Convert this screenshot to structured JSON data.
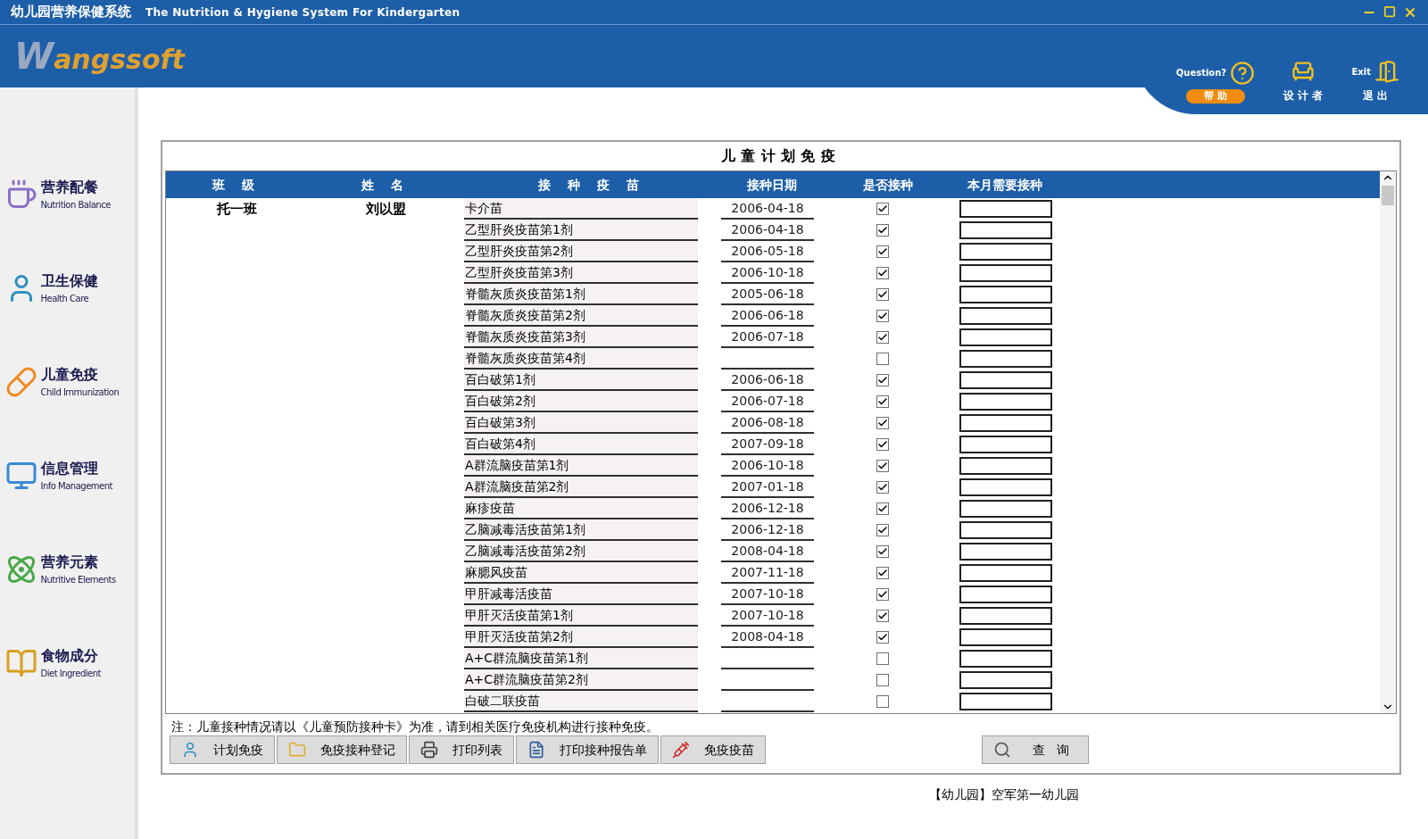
{
  "window": {
    "title": "幼儿园营养保健系统",
    "subtitle": "The Nutrition & Hygiene System For Kindergarten"
  },
  "logo": "Wangssoft",
  "top_actions": [
    {
      "kind": "help",
      "caption": "Question?",
      "label": "帮 助"
    },
    {
      "kind": "designer",
      "label": "设 计 者"
    },
    {
      "kind": "exit",
      "caption": "Exit",
      "label": "退 出"
    }
  ],
  "sidebar": {
    "items": [
      {
        "kind": "nutrition",
        "title": "营养配餐",
        "subtitle": "Nutrition Balance"
      },
      {
        "kind": "health",
        "title": "卫生保健",
        "subtitle": "Health Care"
      },
      {
        "kind": "immunization",
        "title": "儿童免疫",
        "subtitle": "Child Immunization"
      },
      {
        "kind": "info",
        "title": "信息管理",
        "subtitle": "Info Management"
      },
      {
        "kind": "elements",
        "title": "营养元素",
        "subtitle": "Nutritive Elements"
      },
      {
        "kind": "diet",
        "title": "食物成分",
        "subtitle": "Diet Ingredient"
      }
    ]
  },
  "panel": {
    "title": "儿童计划免疫"
  },
  "table": {
    "columns": [
      "班 级",
      "姓 名",
      "接 种 疫 苗",
      "接种日期",
      "是否接种",
      "本月需要接种"
    ],
    "student": {
      "class": "托一班",
      "name": "刘以盟"
    },
    "rows": [
      {
        "vaccine": "卡介苗",
        "date": "2006-04-18",
        "checked": true
      },
      {
        "vaccine": "乙型肝炎疫苗第1剂",
        "date": "2006-04-18",
        "checked": true
      },
      {
        "vaccine": "乙型肝炎疫苗第2剂",
        "date": "2006-05-18",
        "checked": true
      },
      {
        "vaccine": "乙型肝炎疫苗第3剂",
        "date": "2006-10-18",
        "checked": true
      },
      {
        "vaccine": "脊髓灰质炎疫苗第1剂",
        "date": "2005-06-18",
        "checked": true
      },
      {
        "vaccine": "脊髓灰质炎疫苗第2剂",
        "date": "2006-06-18",
        "checked": true
      },
      {
        "vaccine": "脊髓灰质炎疫苗第3剂",
        "date": "2006-07-18",
        "checked": true
      },
      {
        "vaccine": "脊髓灰质炎疫苗第4剂",
        "checked": false
      },
      {
        "vaccine": "百白破第1剂",
        "date": "2006-06-18",
        "checked": true
      },
      {
        "vaccine": "百白破第2剂",
        "date": "2006-07-18",
        "checked": true
      },
      {
        "vaccine": "百白破第3剂",
        "date": "2006-08-18",
        "checked": true
      },
      {
        "vaccine": "百白破第4剂",
        "date": "2007-09-18",
        "checked": true
      },
      {
        "vaccine": "A群流脑疫苗第1剂",
        "date": "2006-10-18",
        "checked": true
      },
      {
        "vaccine": "A群流脑疫苗第2剂",
        "date": "2007-01-18",
        "checked": true
      },
      {
        "vaccine": "麻疹疫苗",
        "date": "2006-12-18",
        "checked": true
      },
      {
        "vaccine": "乙脑减毒活疫苗第1剂",
        "date": "2006-12-18",
        "checked": true
      },
      {
        "vaccine": "乙脑减毒活疫苗第2剂",
        "date": "2008-04-18",
        "checked": true
      },
      {
        "vaccine": "麻腮风疫苗",
        "date": "2007-11-18",
        "checked": true
      },
      {
        "vaccine": "甲肝减毒活疫苗",
        "date": "2007-10-18",
        "checked": true
      },
      {
        "vaccine": "甲肝灭活疫苗第1剂",
        "date": "2007-10-18",
        "checked": true
      },
      {
        "vaccine": "甲肝灭活疫苗第2剂",
        "date": "2008-04-18",
        "checked": true
      },
      {
        "vaccine": "A+C群流脑疫苗第1剂",
        "checked": false
      },
      {
        "vaccine": "A+C群流脑疫苗第2剂",
        "checked": false
      },
      {
        "vaccine": "白破二联疫苗",
        "checked": false
      }
    ]
  },
  "note": "注：儿童接种情况请以《儿童预防接种卡》为准，请到相关医疗免疫机构进行接种免疫。",
  "buttons": [
    {
      "kind": "plan",
      "label": "计划免疫"
    },
    {
      "kind": "register",
      "label": "免疫接种登记"
    },
    {
      "kind": "print",
      "label": "打印列表"
    },
    {
      "kind": "report",
      "label": "打印接种报告单"
    },
    {
      "kind": "vaccine",
      "label": "免疫疫苗"
    }
  ],
  "query_button": {
    "label": "查 询"
  },
  "footer": "【幼儿园】空军第一幼儿园"
}
